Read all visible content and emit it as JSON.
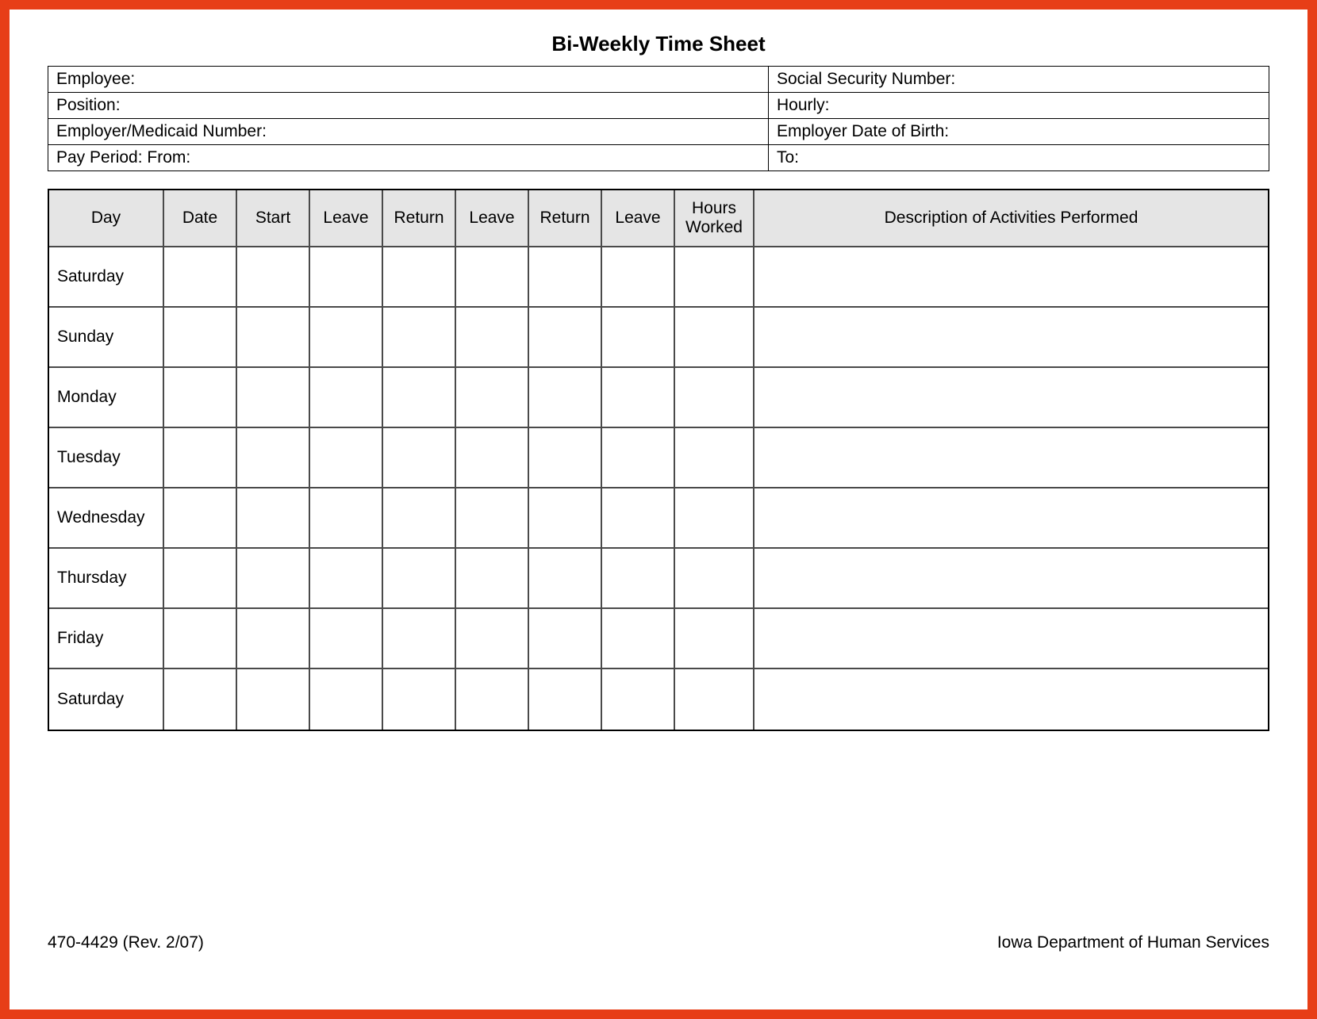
{
  "title": "Bi-Weekly Time Sheet",
  "info": {
    "employee_label": "Employee:",
    "ssn_label": "Social Security Number:",
    "position_label": "Position:",
    "hourly_label": "Hourly:",
    "employer_medicaid_label": "Employer/Medicaid Number:",
    "employer_dob_label": "Employer Date of Birth:",
    "pay_period_from_label": "Pay Period:  From:",
    "pay_period_to_label": "To:"
  },
  "headers": {
    "day": "Day",
    "date": "Date",
    "start": "Start",
    "leave1": "Leave",
    "return1": "Return",
    "leave2": "Leave",
    "return2": "Return",
    "leave3": "Leave",
    "hours_worked": "Hours Worked",
    "description": "Description of Activities Performed"
  },
  "rows": [
    {
      "day": "Saturday"
    },
    {
      "day": "Sunday"
    },
    {
      "day": "Monday"
    },
    {
      "day": "Tuesday"
    },
    {
      "day": "Wednesday"
    },
    {
      "day": "Thursday"
    },
    {
      "day": "Friday"
    },
    {
      "day": "Saturday"
    }
  ],
  "footer": {
    "form_number": "470-4429  (Rev. 2/07)",
    "department": "Iowa Department of Human Services"
  }
}
